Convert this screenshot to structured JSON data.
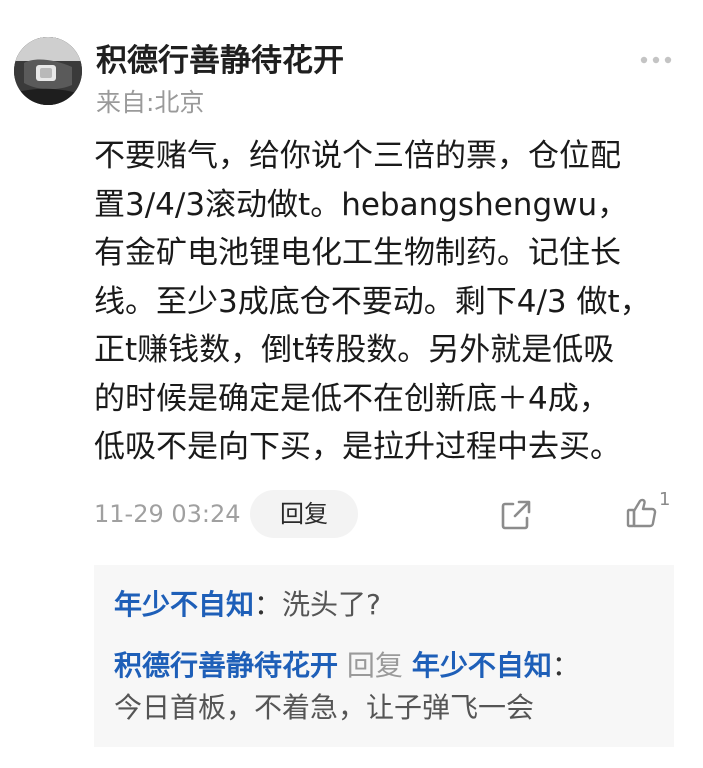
{
  "comment": {
    "username": "积德行善静待花开",
    "location": "来自:北京",
    "body_lines": [
      "不要赌气，给你说个三倍的票，仓位配",
      "置3/4/3滚动做t。hebangshengwu，",
      "有金矿电池锂电化工生物制药。记住长",
      "线。至少3成底仓不要动。剩下4/3 做t，",
      "正t赚钱数，倒t转股数。另外就是低吸",
      "的时候是确定是低不在创新底＋4成，",
      "低吸不是向下买，是拉升过程中去买。"
    ],
    "timestamp": "11-29 03:24",
    "reply_label": "回复",
    "like_count": "1",
    "icons": {
      "more": "more-dots-icon",
      "share": "share-icon",
      "like": "thumbs-up-icon"
    }
  },
  "replies": [
    {
      "author": "年少不自知",
      "separator": "：",
      "content": "洗头了?"
    },
    {
      "author": "积德行善静待花开",
      "reply_word": "回复",
      "target": "年少不自知",
      "separator": "：",
      "content": "今日首板，不着急，让子弹飞一会"
    }
  ],
  "colors": {
    "link": "#1e5fb8",
    "muted": "#9a9a9a",
    "reply_bg": "#f7f7f7"
  }
}
